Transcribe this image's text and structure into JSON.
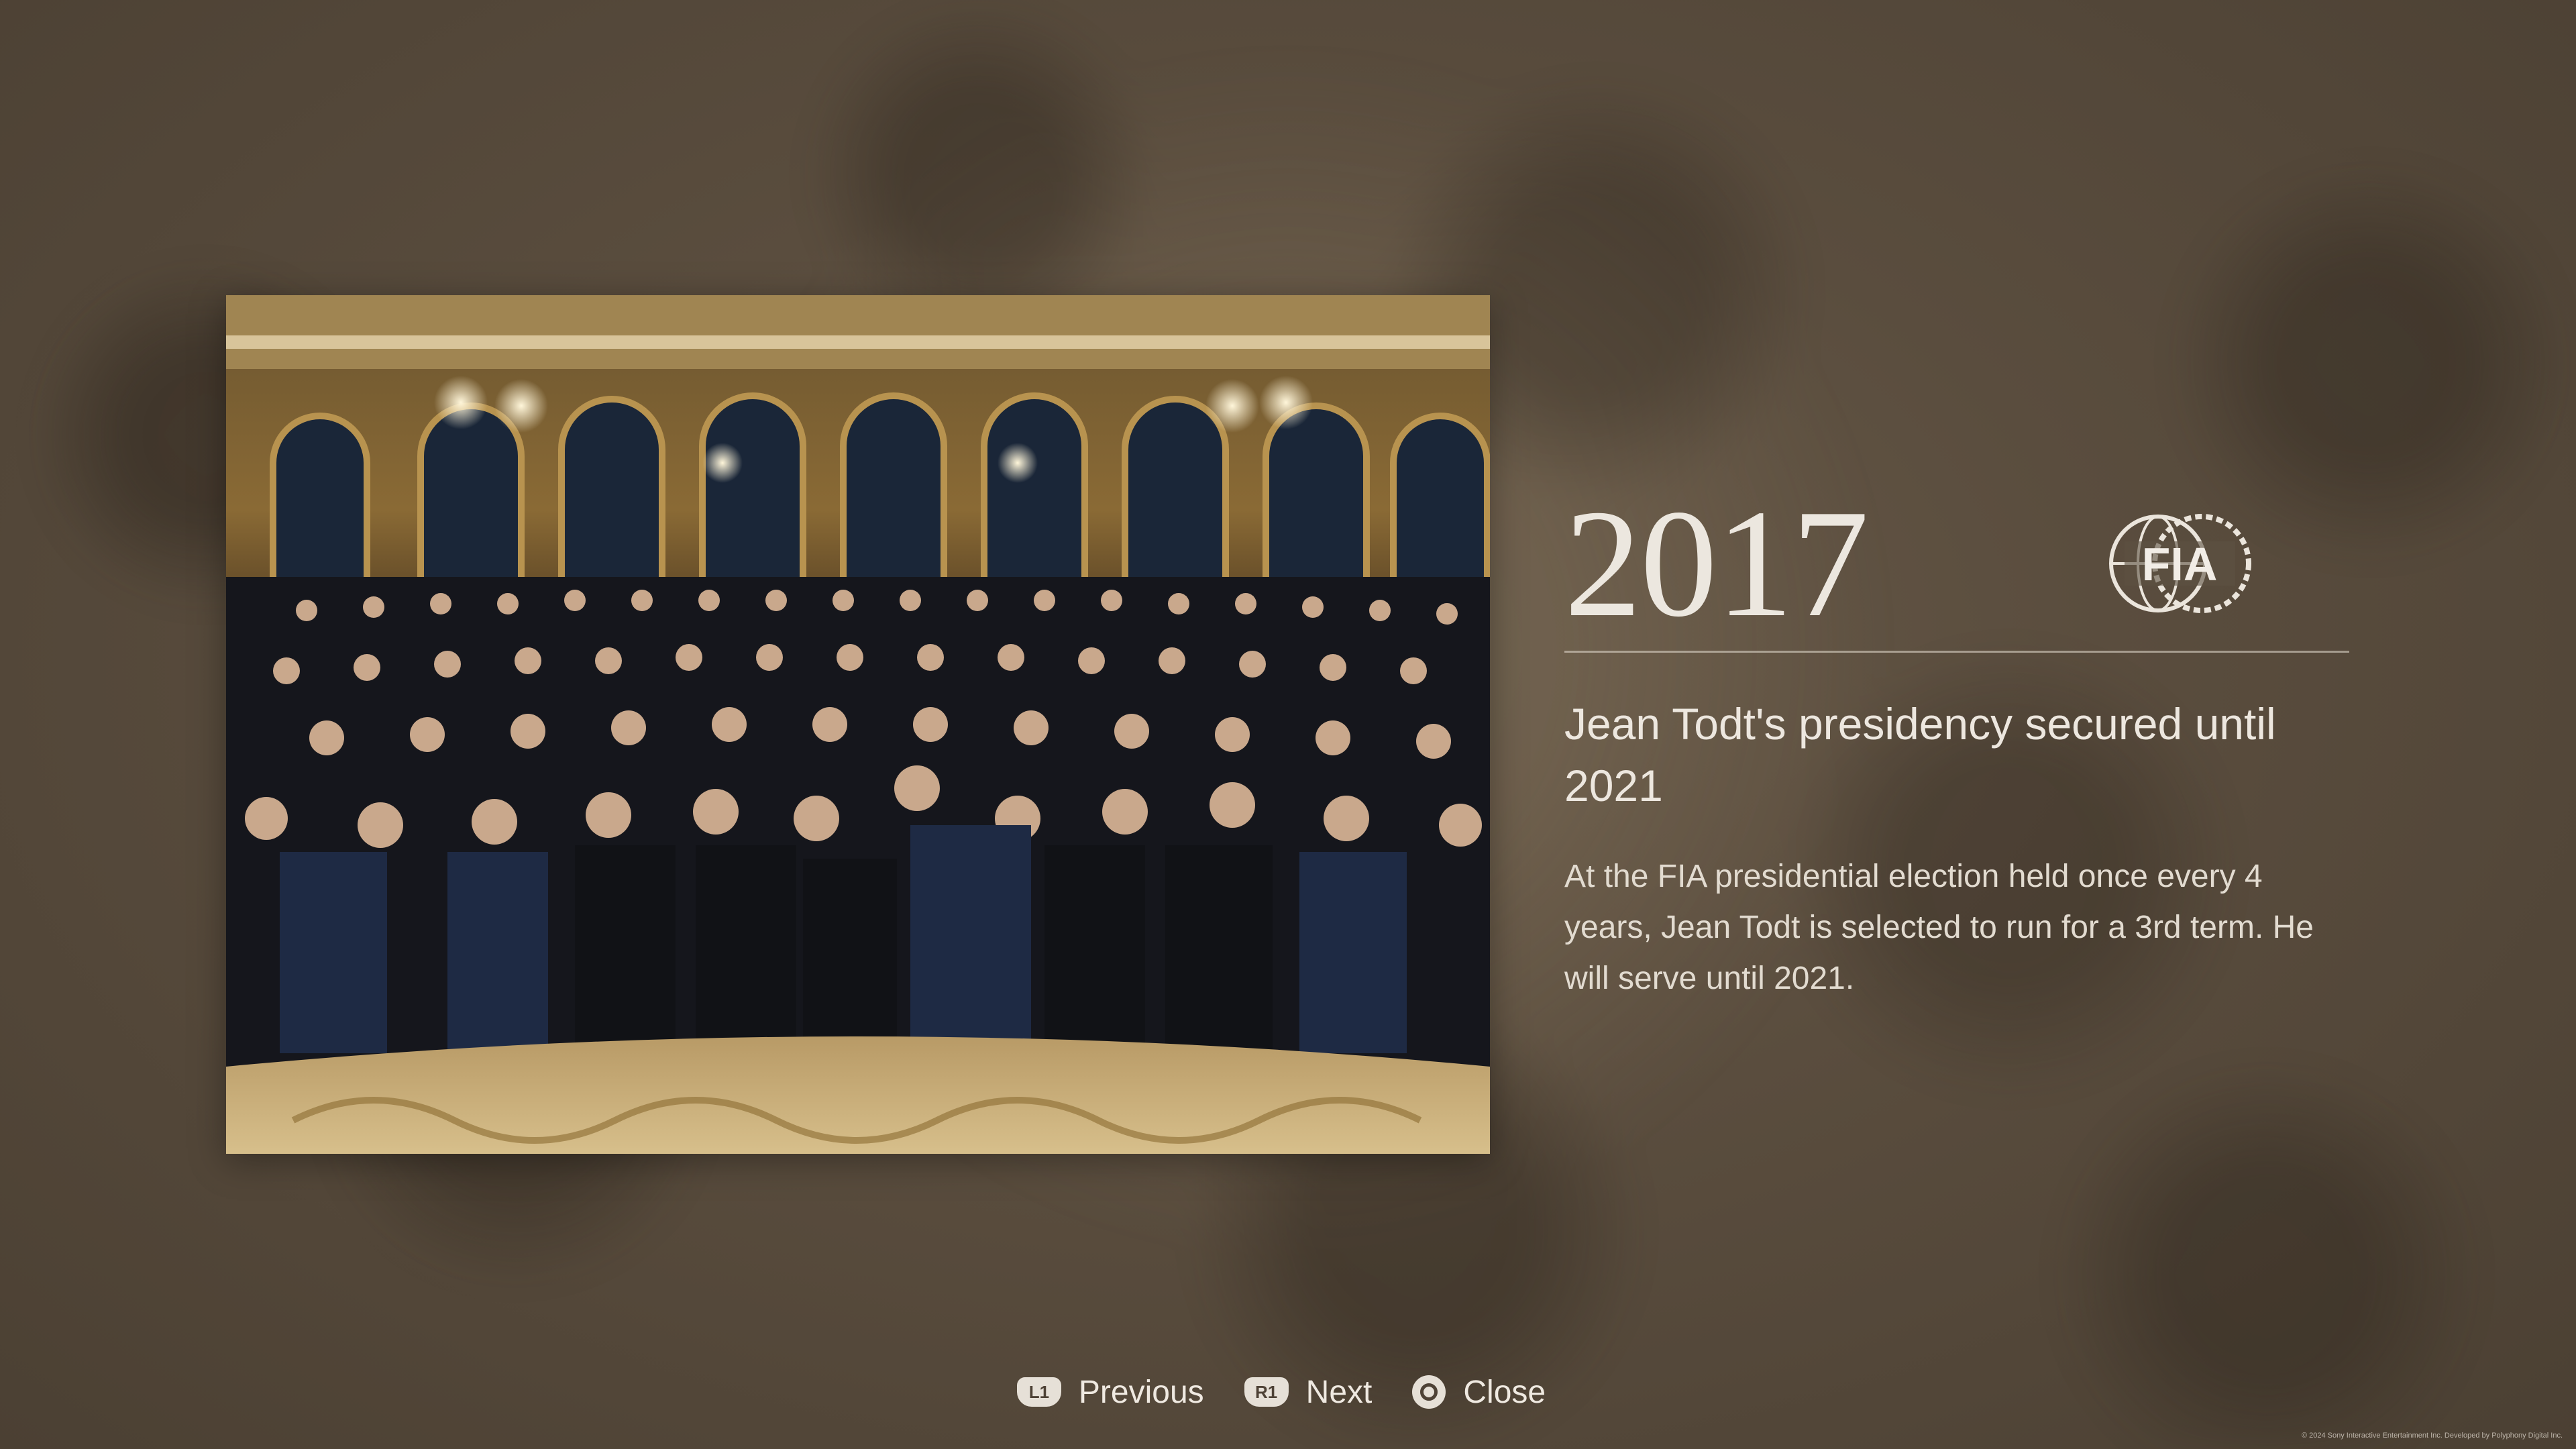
{
  "article": {
    "year": "2017",
    "headline": "Jean Todt's presidency secured until 2021",
    "body": "At the FIA presidential election held once every 4 years, Jean Todt is selected to run for a 3rd term. He will serve until 2021.",
    "logo_text": "FIA",
    "logo_icon": "fia-logo"
  },
  "photo": {
    "icon": "group-photo-image"
  },
  "controls": {
    "previous": {
      "button": "L1",
      "label": "Previous"
    },
    "next": {
      "button": "R1",
      "label": "Next"
    },
    "close": {
      "icon": "circle-button-icon",
      "label": "Close"
    }
  },
  "footer": {
    "copyright": "© 2024 Sony Interactive Entertainment Inc. Developed by Polyphony Digital Inc."
  },
  "colors": {
    "background": "#5a4d3e",
    "text": "#ece7df",
    "badge": "#e6e0d7"
  }
}
